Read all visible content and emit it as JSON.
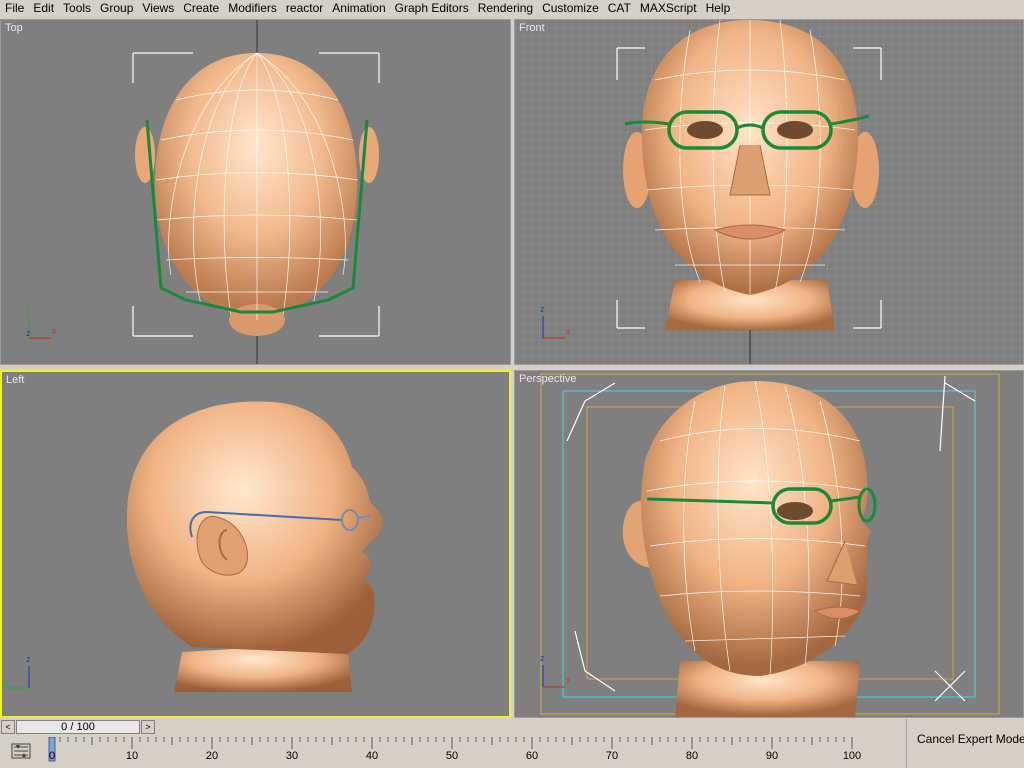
{
  "menu": [
    "File",
    "Edit",
    "Tools",
    "Group",
    "Views",
    "Create",
    "Modifiers",
    "reactor",
    "Animation",
    "Graph Editors",
    "Rendering",
    "Customize",
    "CAT",
    "MAXScript",
    "Help"
  ],
  "viewports": {
    "top": {
      "label": "Top"
    },
    "front": {
      "label": "Front"
    },
    "left": {
      "label": "Left"
    },
    "perspective": {
      "label": "Perspective"
    }
  },
  "axes": {
    "x": "x",
    "y": "y",
    "z": "z"
  },
  "timeslider": {
    "frame_text": "0 / 100",
    "prev": "<",
    "next": ">"
  },
  "trackbar": {
    "ticks": [
      "0",
      "10",
      "20",
      "30",
      "40",
      "50",
      "60",
      "70",
      "80",
      "90",
      "100"
    ]
  },
  "expert_mode": {
    "cancel_label": "Cancel Expert Mode"
  },
  "colors": {
    "viewport_bg": "#7f7f7f",
    "active_border": "#f4ee30",
    "skin": "#f0b88a",
    "glasses": "#1a8a3a",
    "wire": "#ffffff"
  }
}
